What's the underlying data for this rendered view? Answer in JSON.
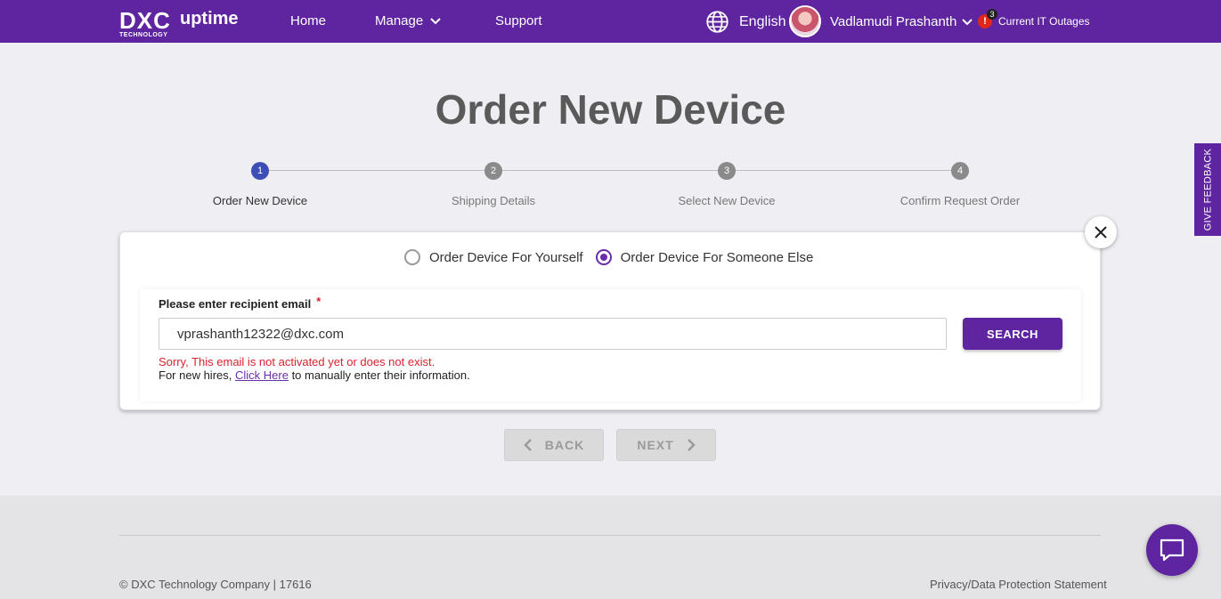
{
  "header": {
    "logo_text": "DXC",
    "logo_sub": "TECHNOLOGY",
    "brand": "uptime",
    "nav": {
      "home": "Home",
      "manage": "Manage",
      "support": "Support"
    },
    "language": "English",
    "user_name": "Vadlamudi Prashanth",
    "alert_count": "3",
    "outages": "Current IT Outages"
  },
  "page": {
    "title": "Order New Device"
  },
  "stepper": {
    "steps": [
      {
        "number": "1",
        "label": "Order New Device",
        "active": true
      },
      {
        "number": "2",
        "label": "Shipping Details",
        "active": false
      },
      {
        "number": "3",
        "label": "Select New Device",
        "active": false
      },
      {
        "number": "4",
        "label": "Confirm Request Order",
        "active": false
      }
    ]
  },
  "form": {
    "option_self": "Order Device For Yourself",
    "option_other": "Order Device For Someone Else",
    "selected_option": "option_other",
    "email_label": "Please enter recipient email",
    "required_mark": "*",
    "email_value": "vprashanth12322@dxc.com",
    "search_label": "SEARCH",
    "error_text": "Sorry, This email is not activated yet or does not exist.",
    "hint_prefix": "For new hires, ",
    "hint_link": "Click Here",
    "hint_suffix": " to manually enter their information."
  },
  "actions": {
    "back": "BACK",
    "next": "NEXT"
  },
  "footer": {
    "copyright": "© DXC Technology Company | 17616",
    "privacy": "Privacy/Data Protection Statement"
  },
  "feedback": "GIVE FEEDBACK",
  "colors": {
    "brand_purple": "#5f249f",
    "step_active": "#3d4fb6",
    "error_red": "#d9232e"
  }
}
